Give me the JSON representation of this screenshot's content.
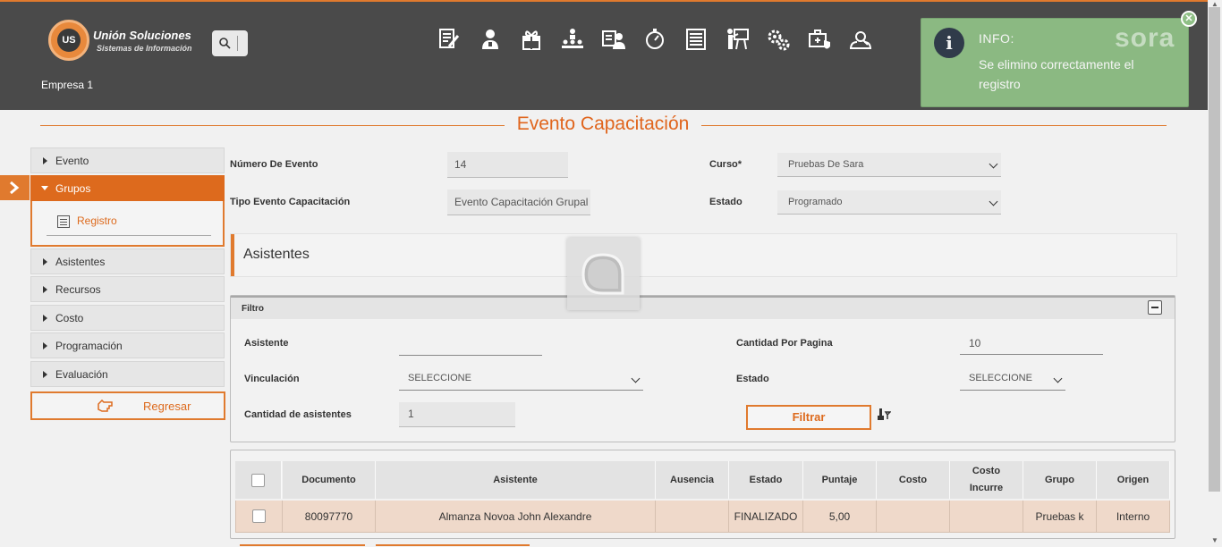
{
  "header": {
    "logo_badge": "US",
    "logo_title": "Unión Soluciones",
    "logo_subtitle": "Sistemas de Información",
    "company": "Empresa 1",
    "nav_icons": [
      "edit-document-icon",
      "user-training-icon",
      "gift-icon",
      "hierarchy-icon",
      "user-card-icon",
      "stopwatch-icon",
      "list-document-icon",
      "presentation-icon",
      "gears-icon",
      "medical-case-icon",
      "supervisor-icon"
    ]
  },
  "toast": {
    "title": "INFO:",
    "message": "Se elimino correctamente el registro",
    "brand": "sora",
    "color": "#8fbf86"
  },
  "page": {
    "title": "Evento Capacitación",
    "accent": "#e07a2e"
  },
  "sidebar": {
    "items": [
      {
        "label": "Evento"
      },
      {
        "label": "Grupos"
      },
      {
        "label": "Asistentes"
      },
      {
        "label": "Recursos"
      },
      {
        "label": "Costo"
      },
      {
        "label": "Programación"
      },
      {
        "label": "Evaluación"
      }
    ],
    "sub_item": "Registro",
    "back_label": "Regresar"
  },
  "form": {
    "numero_label": "Número De Evento",
    "numero_value": "14",
    "curso_label": "Curso*",
    "curso_value": "Pruebas De Sara",
    "tipo_label": "Tipo Evento Capacitación",
    "tipo_value": "Evento Capacitación Grupal",
    "estado_label": "Estado",
    "estado_value": "Programado"
  },
  "asistentes": {
    "title": "Asistentes"
  },
  "filtro": {
    "title": "Filtro",
    "asistente_label": "Asistente",
    "asistente_value": "",
    "cantidad_pagina_label": "Cantidad Por Pagina",
    "cantidad_pagina_value": "10",
    "vinculacion_label": "Vinculación",
    "vinculacion_value": "SELECCIONE",
    "estado_label": "Estado",
    "estado_value": "SELECCIONE",
    "cantidad_asistentes_label": "Cantidad de asistentes",
    "cantidad_asistentes_value": "1",
    "filtrar_label": "Filtrar"
  },
  "table": {
    "headers": [
      "",
      "Documento",
      "Asistente",
      "Ausencia",
      "Estado",
      "Puntaje",
      "Costo",
      "Costo Incurre",
      "Grupo",
      "Origen"
    ],
    "rows": [
      [
        "",
        "80097770",
        "Almanza Novoa John Alexandre",
        "",
        "FINALIZADO",
        "5,00",
        "",
        "",
        "Pruebas k",
        "Interno"
      ]
    ]
  }
}
